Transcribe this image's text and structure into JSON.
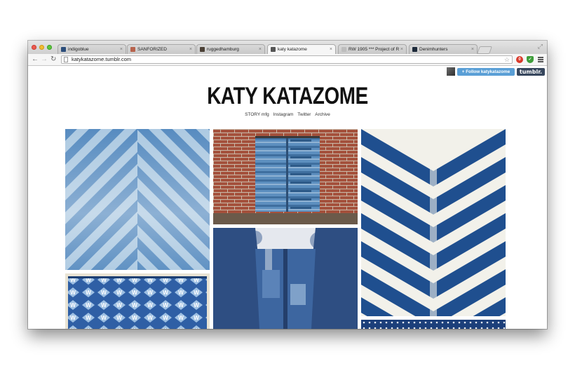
{
  "browser": {
    "tabs": [
      {
        "title": "indigoblue",
        "favicon_color": "#2b4d7a",
        "active": false
      },
      {
        "title": "SANFORIZED",
        "favicon_color": "#b7634d",
        "active": false
      },
      {
        "title": "ruggedhamburg",
        "favicon_color": "#4b4036",
        "active": false
      },
      {
        "title": "katy katazome",
        "favicon_color": "#555555",
        "active": true
      },
      {
        "title": "RW 1905 *** Project of Ro",
        "favicon_color": "#bdbdbd",
        "active": false
      },
      {
        "title": "Denimhunters",
        "favicon_color": "#1d2a3a",
        "active": false
      }
    ],
    "url": "katykatazome.tumblr.com"
  },
  "header": {
    "follow_label": "+ Follow katykatazome",
    "tumblr_label": "tumblr.",
    "title": "KATY KATAZOME",
    "nav": [
      "STORY mfg",
      "Instagram",
      "Twitter",
      "Archive"
    ]
  },
  "posts": [
    {
      "subject": "indigo-chevron-shibori-fabric"
    },
    {
      "subject": "boro-indigo-noren-on-brick-wall"
    },
    {
      "subject": "indigo-ikat-chevron-fabric"
    },
    {
      "subject": "indigo-woven-w-pattern-textile"
    },
    {
      "subject": "patched-indigo-denim-overalls"
    },
    {
      "subject": "indigo-dotted-fabric"
    }
  ],
  "colors": {
    "indigo_dark": "#21477d",
    "indigo_mid": "#4f7fb3",
    "indigo_light": "#9dbfd9",
    "brick": "#a4513c",
    "tumblr": "#36465d",
    "follow": "#5a9fd6"
  }
}
